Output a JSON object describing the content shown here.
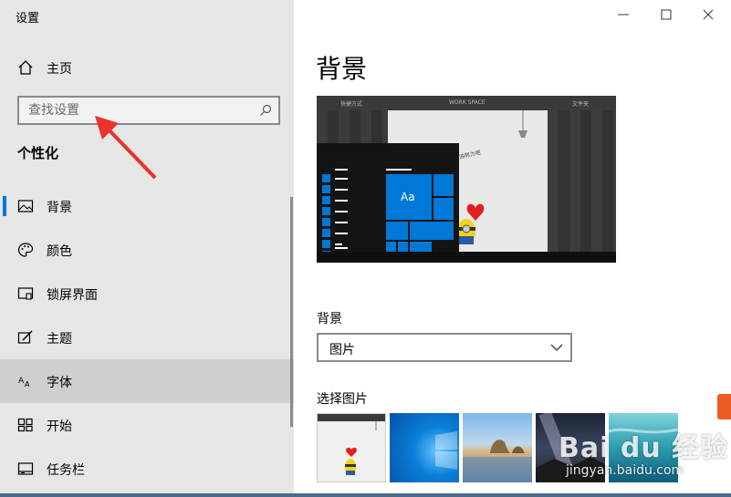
{
  "window": {
    "title": "设置"
  },
  "sidebar": {
    "home_label": "主页",
    "search_placeholder": "查找设置",
    "section_title": "个性化",
    "items": [
      {
        "label": "背景",
        "icon": "picture-icon",
        "active": true
      },
      {
        "label": "颜色",
        "icon": "palette-icon"
      },
      {
        "label": "锁屏界面",
        "icon": "lock-screen-icon"
      },
      {
        "label": "主题",
        "icon": "theme-icon"
      },
      {
        "label": "字体",
        "icon": "font-icon",
        "hover": true
      },
      {
        "label": "开始",
        "icon": "start-icon"
      },
      {
        "label": "任务栏",
        "icon": "taskbar-icon"
      }
    ]
  },
  "main": {
    "page_title": "背景",
    "preview": {
      "topbar": [
        "快捷方式",
        "WORK SPACE",
        "文件夹"
      ],
      "tile_text": "Aa"
    },
    "background_label": "背景",
    "background_value": "图片",
    "choose_picture_label": "选择图片",
    "thumbnails": [
      "minion-wall-thumbnail",
      "windows-blue-thumbnail",
      "beach-rocks-thumbnail",
      "milky-way-thumbnail",
      "underwater-thumbnail"
    ]
  },
  "watermark": {
    "text": "Bai du 经验",
    "sub": "jingyan.baidu.com"
  },
  "colors": {
    "accent": "#0078d7",
    "sidebar_bg": "#e6e6e6",
    "arrow": "#e8322a"
  }
}
